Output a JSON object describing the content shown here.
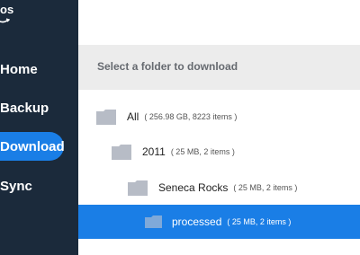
{
  "sidebar": {
    "logo_text": "os",
    "items": [
      {
        "label": "Home",
        "active": false
      },
      {
        "label": "Backup",
        "active": false
      },
      {
        "label": "Download",
        "active": true
      },
      {
        "label": "Sync",
        "active": false
      }
    ]
  },
  "main": {
    "header_title": "Select a folder to download",
    "tree": [
      {
        "name": "All",
        "meta": "( 256.98 GB, 8223 items )",
        "selected": false
      },
      {
        "name": "2011",
        "meta": "( 25 MB, 2 items )",
        "selected": false
      },
      {
        "name": "Seneca Rocks",
        "meta": "( 25 MB, 2 items )",
        "selected": false
      },
      {
        "name": "processed",
        "meta": "( 25 MB, 2 items )",
        "selected": true
      }
    ]
  },
  "colors": {
    "sidebar_bg": "#1b2a3b",
    "accent": "#1a7ee6",
    "header_bg": "#ececec",
    "folder": "#b7bcc6",
    "folder_selected": "#7fa9d9"
  },
  "icons": {
    "folder": "folder-icon",
    "logo_arrow": "amazon-smile-icon"
  }
}
